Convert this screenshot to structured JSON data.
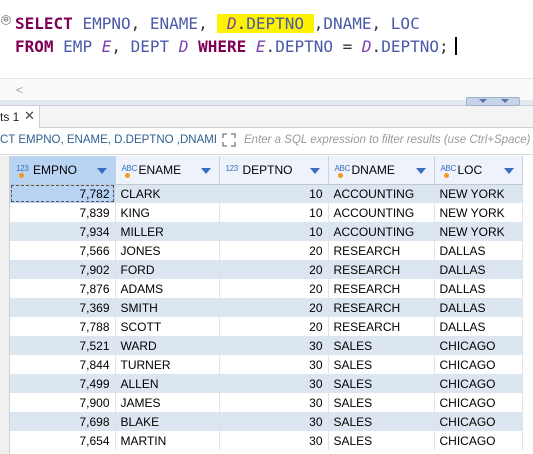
{
  "editor": {
    "line1": {
      "select": "SELECT",
      "col1": "EMPNO",
      "c1": ",",
      "col2": "ENAME",
      "c2": ",",
      "col3_alias": "D",
      "col3_dot": ".",
      "col3_name": "DEPTNO",
      "c3": ",",
      "col4": "DNAME",
      "c4": ",",
      "col5": "LOC"
    },
    "line2": {
      "from": "FROM",
      "t1": "EMP",
      "a1": "E",
      "c1": ",",
      "t2": "DEPT",
      "a2": "D",
      "where": "WHERE",
      "l_alias": "E",
      "l_dot": ".",
      "l_col": "DEPTNO",
      "eq": "=",
      "r_alias": "D",
      "r_dot": ".",
      "r_col": "DEPTNO",
      "semi": ";"
    },
    "fold_glyph": "⊖",
    "highlight_color": "#fff200"
  },
  "scroll": {
    "left_arrow": "<"
  },
  "results_tab": {
    "label": "ts 1",
    "close": "✕"
  },
  "filter": {
    "query": "CT EMPNO, ENAME, D.DEPTNO ,DNAME",
    "placeholder": "Enter a SQL expression to filter results (use Ctrl+Space)"
  },
  "columns": [
    {
      "type_icon": "123",
      "label": "EMPNO"
    },
    {
      "type_icon": "ABC",
      "label": "ENAME"
    },
    {
      "type_icon": "123",
      "label": "DEPTNO"
    },
    {
      "type_icon": "ABC",
      "label": "DNAME"
    },
    {
      "type_icon": "ABC",
      "label": "LOC"
    }
  ],
  "rows": [
    [
      "7,782",
      "CLARK",
      "10",
      "ACCOUNTING",
      "NEW YORK"
    ],
    [
      "7,839",
      "KING",
      "10",
      "ACCOUNTING",
      "NEW YORK"
    ],
    [
      "7,934",
      "MILLER",
      "10",
      "ACCOUNTING",
      "NEW YORK"
    ],
    [
      "7,566",
      "JONES",
      "20",
      "RESEARCH",
      "DALLAS"
    ],
    [
      "7,902",
      "FORD",
      "20",
      "RESEARCH",
      "DALLAS"
    ],
    [
      "7,876",
      "ADAMS",
      "20",
      "RESEARCH",
      "DALLAS"
    ],
    [
      "7,369",
      "SMITH",
      "20",
      "RESEARCH",
      "DALLAS"
    ],
    [
      "7,788",
      "SCOTT",
      "20",
      "RESEARCH",
      "DALLAS"
    ],
    [
      "7,521",
      "WARD",
      "30",
      "SALES",
      "CHICAGO"
    ],
    [
      "7,844",
      "TURNER",
      "30",
      "SALES",
      "CHICAGO"
    ],
    [
      "7,499",
      "ALLEN",
      "30",
      "SALES",
      "CHICAGO"
    ],
    [
      "7,900",
      "JAMES",
      "30",
      "SALES",
      "CHICAGO"
    ],
    [
      "7,698",
      "BLAKE",
      "30",
      "SALES",
      "CHICAGO"
    ],
    [
      "7,654",
      "MARTIN",
      "30",
      "SALES",
      "CHICAGO"
    ]
  ],
  "colors": {
    "keyword": "#7f0055",
    "identifier": "#4a5aa8",
    "alias": "#7a3fb3",
    "row_alt": "#dce6f1",
    "header_selected": "#b9d4f2"
  }
}
